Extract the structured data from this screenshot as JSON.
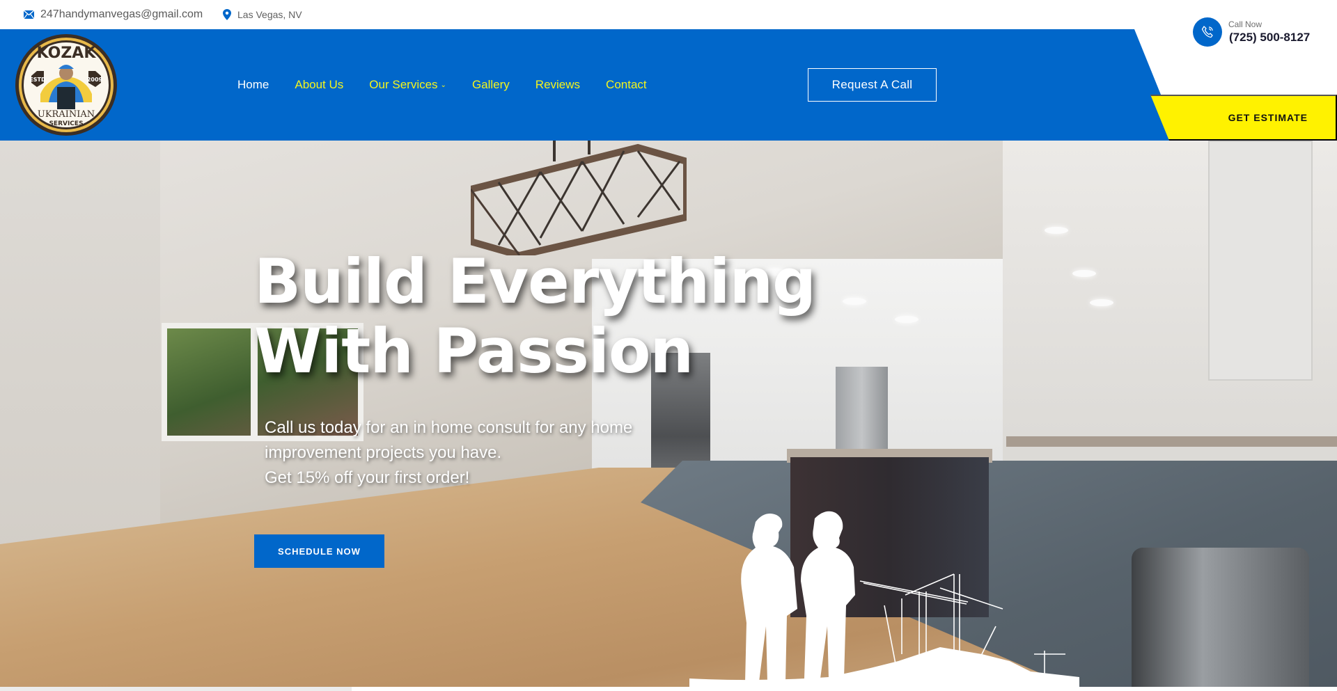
{
  "topbar": {
    "email": "247handymanvegas@gmail.com",
    "location": "Las Vegas, NV",
    "email_icon": "envelope-icon",
    "location_icon": "map-pin-icon"
  },
  "brand": {
    "logo_alt": "Kozak Ukrainian Services",
    "logo_top": "KOZAK",
    "logo_left_badge": "ESTD",
    "logo_right_badge": "2009",
    "logo_bottom_1": "UKRAINIAN",
    "logo_bottom_2": "SERVICES",
    "colors": {
      "primary": "#0167CA",
      "accent": "#F5F51C",
      "estimate": "#FFF200"
    }
  },
  "nav": {
    "items": [
      {
        "label": "Home",
        "active": true
      },
      {
        "label": "About Us"
      },
      {
        "label": "Our Services",
        "dropdown": true
      },
      {
        "label": "Gallery"
      },
      {
        "label": "Reviews"
      },
      {
        "label": "Contact"
      }
    ],
    "dropdown_icon": "chevron-down-icon"
  },
  "header": {
    "request_call": "Request A Call",
    "call_label": "Call Now",
    "call_number": "(725) 500-8127",
    "call_icon": "phone-icon",
    "get_estimate": "GET ESTIMATE"
  },
  "hero": {
    "title_line1": "Build Everything",
    "title_line2": "With Passion",
    "subtitle_line1": "Call us today for an in home consult for any home improvement projects you have.",
    "subtitle_line2": "Get 15% off your first order!",
    "cta": "SCHEDULE NOW",
    "background_description": "Renovated kitchen with white cabinets, dark island and wood floor",
    "overlay_graphic": "construction-workers-silhouette"
  }
}
